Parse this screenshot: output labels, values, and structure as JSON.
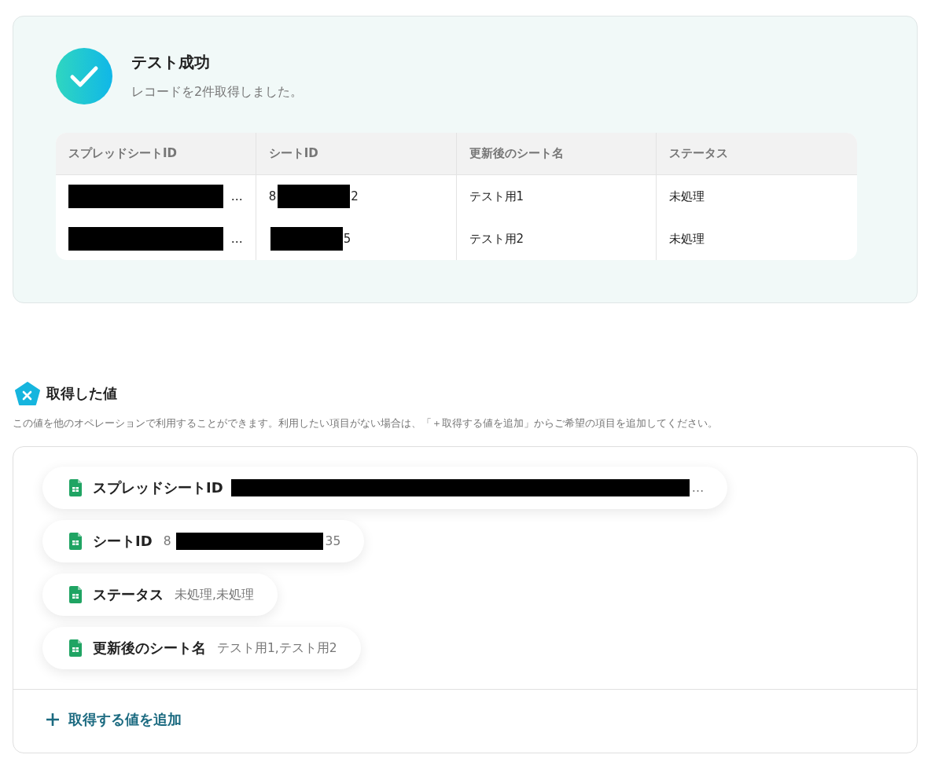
{
  "result": {
    "title": "テスト成功",
    "message": "レコードを2件取得しました。",
    "table": {
      "columns": [
        "スプレッドシートID",
        "シートID",
        "更新後のシート名",
        "ステータス"
      ],
      "rows": [
        [
          {
            "suffix": "…",
            "redacted": true
          },
          {
            "prefix": "8",
            "suffix": "2",
            "redacted": true
          },
          {
            "prefix": "テスト用1"
          },
          {
            "prefix": "未処理"
          }
        ],
        [
          {
            "suffix": "…",
            "redacted": true
          },
          {
            "suffix": "5",
            "redacted": true
          },
          {
            "prefix": "テスト用2"
          },
          {
            "prefix": "未処理"
          }
        ]
      ]
    }
  },
  "values": {
    "title": "取得した値",
    "description": "この値を他のオペレーションで利用することができます。利用したい項目がない場合は、「＋取得する値を追加」からご希望の項目を追加してください。",
    "items": [
      {
        "label": "スプレッドシートID",
        "suffix": "…",
        "redacted": true
      },
      {
        "label": "シートID",
        "prefix": "8",
        "suffix": "35",
        "redacted": true
      },
      {
        "label": "ステータス",
        "prefix": "未処理,未処理"
      },
      {
        "label": "更新後のシート名",
        "prefix": "テスト用1,テスト用2"
      }
    ],
    "add_label": "取得する値を追加"
  }
}
